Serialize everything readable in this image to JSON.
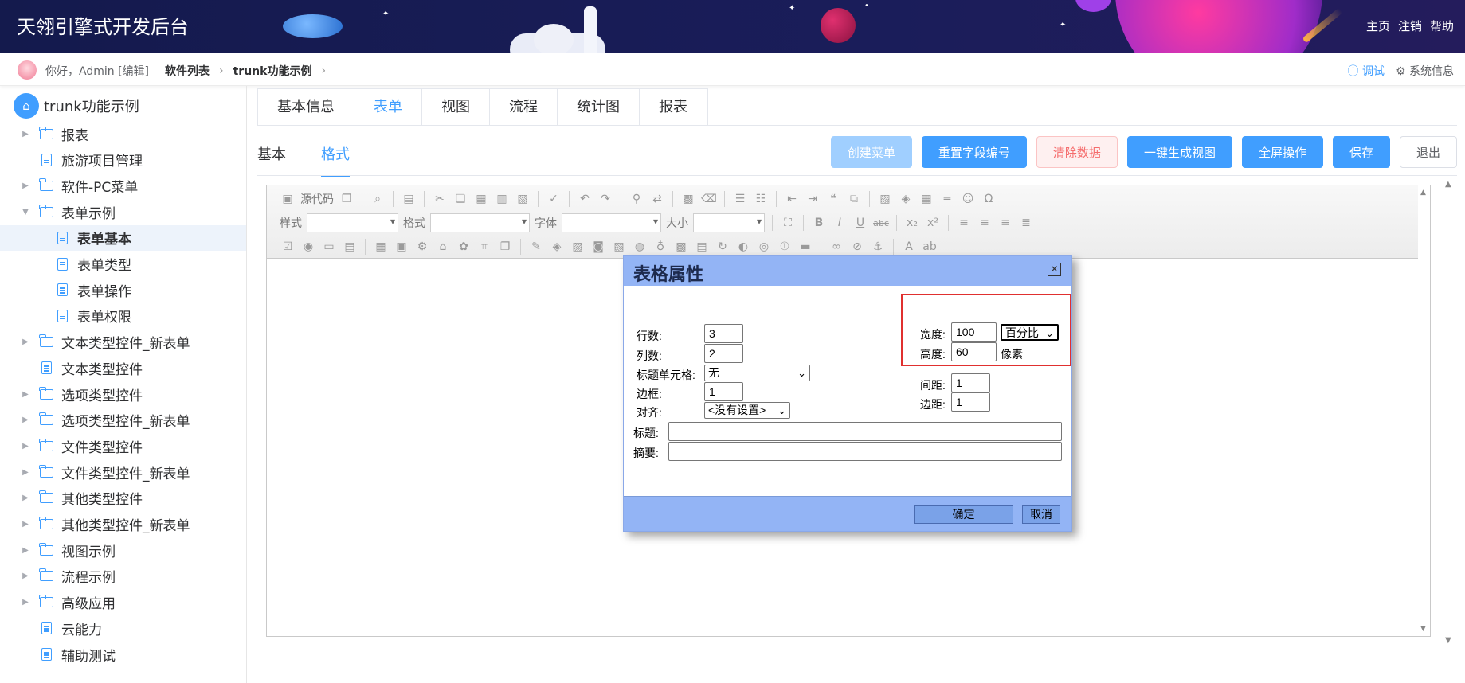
{
  "header": {
    "title": "天翎引擎式开发后台",
    "nav": [
      "主页",
      "注销",
      "帮助"
    ]
  },
  "subheader": {
    "greeting": "你好，Admin [编辑]",
    "breadcrumb": [
      "软件列表",
      "trunk功能示例"
    ],
    "debug": "调试",
    "sysinfo": "系统信息"
  },
  "sidebar": {
    "root": "trunk功能示例",
    "items": [
      {
        "label": "报表",
        "type": "folder",
        "arrow": "▶"
      },
      {
        "label": "旅游项目管理",
        "type": "doc",
        "arrow": ""
      },
      {
        "label": "软件-PC菜单",
        "type": "folder",
        "arrow": "▶"
      },
      {
        "label": "表单示例",
        "type": "folder",
        "arrow": "▼"
      },
      {
        "label": "表单基本",
        "type": "doc",
        "arrow": ""
      },
      {
        "label": "表单类型",
        "type": "doc",
        "arrow": ""
      },
      {
        "label": "表单操作",
        "type": "doc",
        "arrow": ""
      },
      {
        "label": "表单权限",
        "type": "doc",
        "arrow": ""
      },
      {
        "label": "文本类型控件_新表单",
        "type": "folder",
        "arrow": "▶"
      },
      {
        "label": "文本类型控件",
        "type": "doc",
        "arrow": ""
      },
      {
        "label": "选项类型控件",
        "type": "folder",
        "arrow": "▶"
      },
      {
        "label": "选项类型控件_新表单",
        "type": "folder",
        "arrow": "▶"
      },
      {
        "label": "文件类型控件",
        "type": "folder",
        "arrow": "▶"
      },
      {
        "label": "文件类型控件_新表单",
        "type": "folder",
        "arrow": "▶"
      },
      {
        "label": "其他类型控件",
        "type": "folder",
        "arrow": "▶"
      },
      {
        "label": "其他类型控件_新表单",
        "type": "folder",
        "arrow": "▶"
      },
      {
        "label": "视图示例",
        "type": "folder",
        "arrow": "▶"
      },
      {
        "label": "流程示例",
        "type": "folder",
        "arrow": "▶"
      },
      {
        "label": "高级应用",
        "type": "folder",
        "arrow": "▶"
      },
      {
        "label": "云能力",
        "type": "doc",
        "arrow": ""
      },
      {
        "label": "辅助测试",
        "type": "doc",
        "arrow": ""
      }
    ]
  },
  "main": {
    "tabs": [
      "基本信息",
      "表单",
      "视图",
      "流程",
      "统计图",
      "报表"
    ],
    "subtabs": [
      "基本",
      "格式"
    ],
    "buttons": {
      "create_menu": "创建菜单",
      "reset_field": "重置字段编号",
      "clear_data": "清除数据",
      "gen_view": "一键生成视图",
      "fullscreen": "全屏操作",
      "save": "保存",
      "exit": "退出"
    }
  },
  "toolbar": {
    "source": "源代码",
    "style": "样式",
    "format": "格式",
    "font": "字体",
    "size": "大小"
  },
  "dialog": {
    "title": "表格属性",
    "rows_label": "行数:",
    "rows_value": "3",
    "cols_label": "列数:",
    "cols_value": "2",
    "header_label": "标题单元格:",
    "header_value": "无",
    "border_label": "边框:",
    "border_value": "1",
    "align_label": "对齐:",
    "align_value": "<没有设置>",
    "width_label": "宽度:",
    "width_value": "100",
    "width_unit": "百分比",
    "height_label": "高度:",
    "height_value": "60",
    "height_unit": "像素",
    "spacing_label": "间距:",
    "spacing_value": "1",
    "padding_label": "边距:",
    "padding_value": "1",
    "caption_label": "标题:",
    "caption_value": "",
    "summary_label": "摘要:",
    "summary_value": "",
    "ok": "确定",
    "cancel": "取消"
  },
  "colors": {
    "primary": "#409eff",
    "header_bg": "#141a4d",
    "dialog_bar": "#93b4f5",
    "highlight": "#e0302f"
  }
}
